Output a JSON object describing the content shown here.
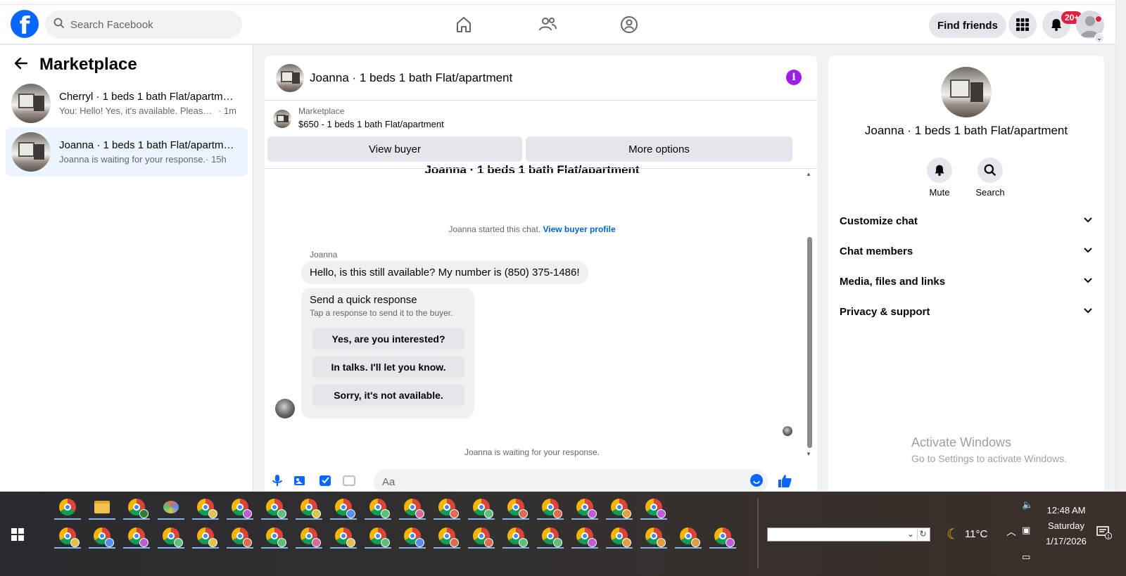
{
  "nav": {
    "search_placeholder": "Search Facebook",
    "find_friends": "Find friends",
    "notification_count": "20+"
  },
  "sidebar": {
    "title": "Marketplace",
    "conversations": [
      {
        "title": "Cherryl · 1 beds 1 bath Flat/apartment",
        "preview": "You: Hello! Yes, it's available. Please s...",
        "time": "· 1m",
        "active": false
      },
      {
        "title": "Joanna · 1 beds 1 bath Flat/apartment",
        "preview": "Joanna is waiting for your response.",
        "time": "· 15h",
        "active": true
      }
    ]
  },
  "chat": {
    "title": "Joanna · 1 beds 1 bath Flat/apartment",
    "marketplace_label": "Marketplace",
    "listing": "$650 - 1 beds 1 bath Flat/apartment",
    "view_buyer": "View buyer",
    "more_options": "More options",
    "cut_title": "Joanna · 1 beds 1 bath Flat/apartment",
    "started_text": "Joanna started this chat.",
    "view_buyer_profile": "View buyer profile",
    "sender": "Joanna",
    "message": "Hello, is this still available? My number is (850) 375-1486!",
    "quick_response": {
      "title": "Send a quick response",
      "subtitle": "Tap a response to send it to the buyer.",
      "options": [
        "Yes, are you interested?",
        "In talks. I'll let you know.",
        "Sorry, it's not available."
      ]
    },
    "waiting": "Joanna is waiting for your response.",
    "composer_placeholder": "Aa"
  },
  "right_panel": {
    "name": "Joanna · 1 beds 1 bath Flat/apartment",
    "actions": [
      "Mute",
      "Search"
    ],
    "sections": [
      "Customize chat",
      "Chat members",
      "Media, files and links",
      "Privacy & support"
    ],
    "watermark_1": "Activate Windows",
    "watermark_2": "Go to Settings to activate Windows."
  },
  "taskbar": {
    "temperature": "11°C",
    "time": "12:48 AM",
    "day": "Saturday",
    "date": "1/17/2026",
    "notification_count": "1",
    "profile_colors_row1": [
      "",
      "",
      "",
      "#5b8def",
      "#e0c24a",
      "#c05ad8",
      "#5fbf7a",
      "#e0c24a",
      "#5b8def",
      "#5fbf7a",
      "#d86a9a",
      "#e06a50",
      "#5fbf7a",
      "#e06a50",
      "#e06a50",
      "#c05ad8",
      "#e0a040",
      "#c05ad8"
    ],
    "profile_colors_row2": [
      "#e0c24a",
      "#5b8def",
      "#c05ad8",
      "#5fbf7a",
      "#e0c24a",
      "#e06a50",
      "#5fbf7a",
      "#d86a9a",
      "#e0c24a",
      "#5fbf7a",
      "#5b8def",
      "#e06a50",
      "#e06a50",
      "#5fbf7a",
      "#5fbf7a",
      "#c05ad8",
      "#e0a040",
      "#e0a040",
      "#e0a040",
      "#c05ad8"
    ]
  }
}
